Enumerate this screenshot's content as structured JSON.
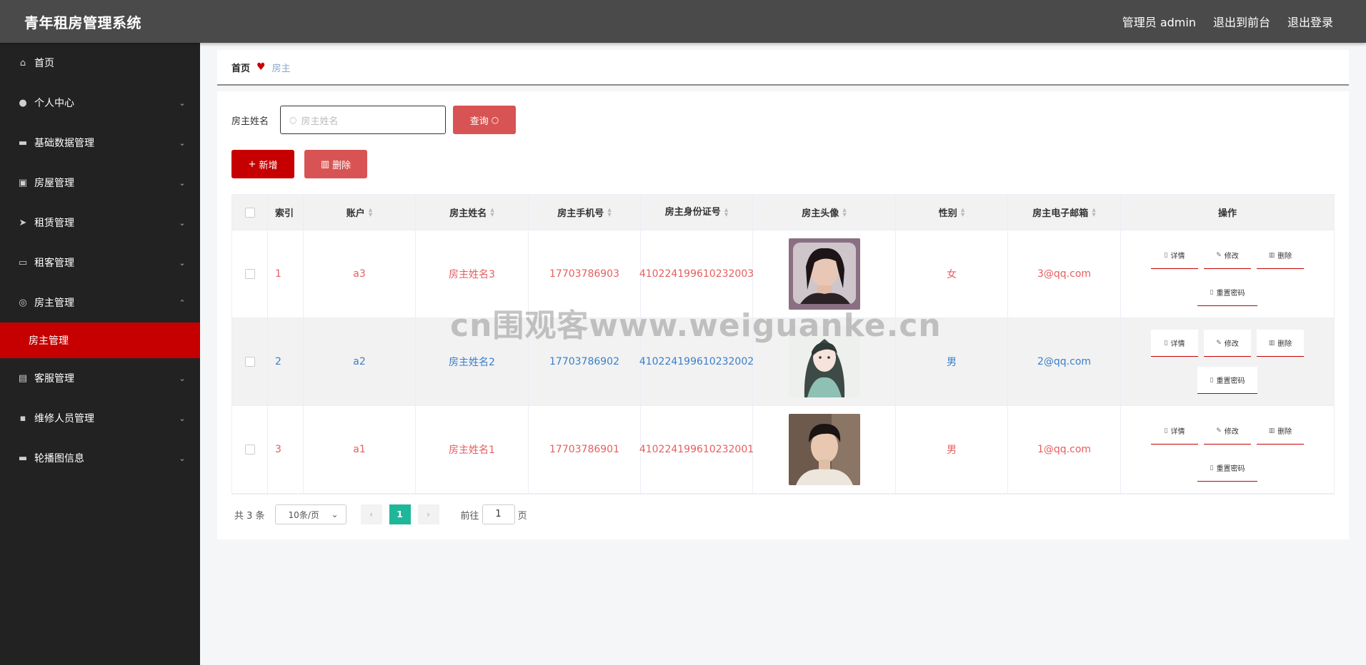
{
  "header": {
    "title": "青年租房管理系统",
    "admin": "管理员 admin",
    "to_front": "退出到前台",
    "logout": "退出登录"
  },
  "sidebar": {
    "items": [
      {
        "label": "首页",
        "icon": "home-icon"
      },
      {
        "label": "个人中心",
        "icon": "user-icon"
      },
      {
        "label": "基础数据管理",
        "icon": "database-icon"
      },
      {
        "label": "房屋管理",
        "icon": "house-icon"
      },
      {
        "label": "租赁管理",
        "icon": "send-icon"
      },
      {
        "label": "租客管理",
        "icon": "monitor-icon"
      },
      {
        "label": "房主管理",
        "icon": "circle-user-icon"
      },
      {
        "label": "客服管理",
        "icon": "clipboard-icon"
      },
      {
        "label": "维修人员管理",
        "icon": "chat-icon"
      },
      {
        "label": "轮播图信息",
        "icon": "image-icon"
      }
    ],
    "active_sub": "房主管理"
  },
  "breadcrumb": {
    "home": "首页",
    "current": "房主"
  },
  "search": {
    "label": "房主姓名",
    "placeholder": "房主姓名",
    "query_label": "查询"
  },
  "actions": {
    "add_label": "新增",
    "delete_label": "删除"
  },
  "table": {
    "headers": [
      "索引",
      "账户",
      "房主姓名",
      "房主手机号",
      "房主身份证号",
      "房主头像",
      "性别",
      "房主电子邮箱",
      "操作"
    ],
    "rows": [
      {
        "index": "1",
        "account": "a3",
        "name": "房主姓名3",
        "phone": "17703786903",
        "id_card": "410224199610232003",
        "avatar": "avatar-woman-pillow",
        "gender": "女",
        "email": "3@qq.com"
      },
      {
        "index": "2",
        "account": "a2",
        "name": "房主姓名2",
        "phone": "17703786902",
        "id_card": "410224199610232002",
        "avatar": "avatar-anime-girl",
        "gender": "男",
        "email": "2@qq.com"
      },
      {
        "index": "3",
        "account": "a1",
        "name": "房主姓名1",
        "phone": "17703786901",
        "id_card": "410224199610232001",
        "avatar": "avatar-young-man",
        "gender": "男",
        "email": "1@qq.com"
      }
    ],
    "ops": {
      "detail": "详情",
      "edit": "修改",
      "delete": "删除",
      "reset": "重置密码"
    }
  },
  "pagination": {
    "total": "共 3 条",
    "size": "10条/页",
    "page": "1",
    "goto_prefix": "前往",
    "goto_value": "1",
    "goto_suffix": "页"
  },
  "watermark": "cn围观客www.weiguanke.cn",
  "colors": {
    "accent": "#c60000",
    "header": "#4a4a4a",
    "sidebar": "#222222",
    "red_row": "#e65e5e",
    "blue_row": "#3a7ec9",
    "page_active": "#1fb79a"
  }
}
